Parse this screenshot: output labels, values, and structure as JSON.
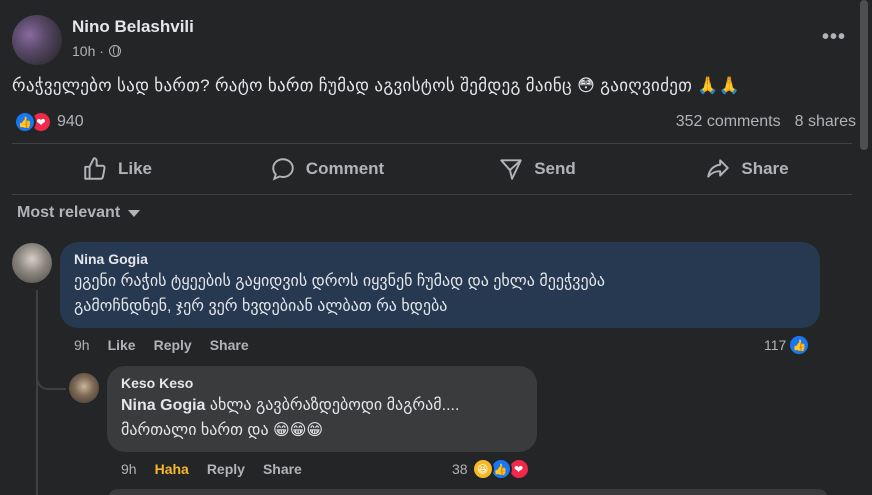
{
  "post": {
    "author": "Nino Belashvili",
    "time": "10h ·",
    "text": "რაჭველებო სად ხართ? რატო ხართ ჩუმად აგვისტოს შემდეგ მაინც 😳 გაიღვიძეთ 🙏🙏",
    "reaction_count": "940",
    "comments_count": "352 comments",
    "shares_count": "8 shares"
  },
  "actions": {
    "like": "Like",
    "comment": "Comment",
    "send": "Send",
    "share": "Share"
  },
  "sort_label": "Most relevant",
  "comments": [
    {
      "name": "Nina Gogia",
      "line1": "ეგენი რაჭის ტყეების გაყიდვის დროს იყვნენ ჩუმად და ეხლა მეეჭვება",
      "line2": "გამოჩნდნენ, ჯერ ვერ ხვდებიან ალბათ რა ხდება",
      "time": "9h",
      "like": "Like",
      "reply": "Reply",
      "share": "Share",
      "reaction_count": "117"
    },
    {
      "name": "Keso Keso",
      "mention": "Nina Gogia",
      "line1_rest": " ახლა გავბრაზდებოდი მაგრამ....",
      "line2": "მართალი ხართ და 😁😁😁",
      "time": "9h",
      "haha": "Haha",
      "reply": "Reply",
      "share": "Share",
      "reaction_count": "38"
    }
  ],
  "colors": {
    "background": "#242526",
    "bubble": "#3a3b3c",
    "bubble_active": "#263951",
    "like_blue": "#1877f2",
    "love_red": "#f02849",
    "haha_yellow": "#f7b928"
  },
  "icons": [
    "globe-icon",
    "more-icon",
    "like-icon",
    "comment-icon",
    "send-icon",
    "share-icon",
    "caret-down-icon"
  ]
}
